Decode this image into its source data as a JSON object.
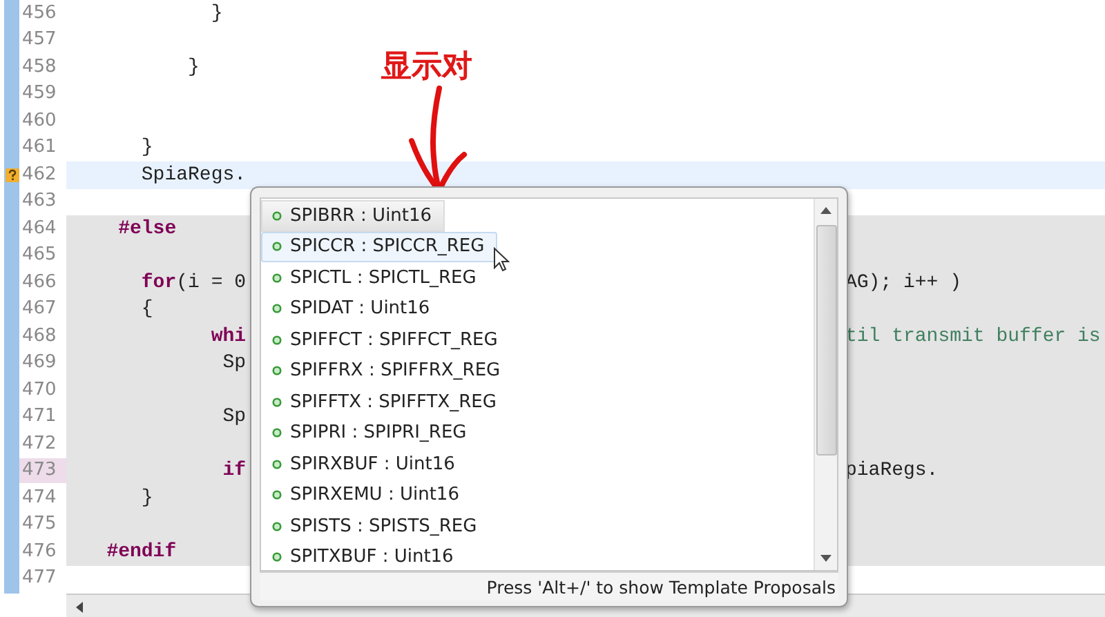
{
  "editor": {
    "lines": [
      {
        "number": "456",
        "current": false,
        "inactive": false,
        "number_highlight": false,
        "marker": false,
        "code": [
          {
            "text": "            }",
            "kind": "plain"
          }
        ]
      },
      {
        "number": "457",
        "current": false,
        "inactive": false,
        "number_highlight": false,
        "marker": false
      },
      {
        "number": "458",
        "current": false,
        "inactive": false,
        "number_highlight": false,
        "marker": false,
        "code": [
          {
            "text": "          }",
            "kind": "plain"
          }
        ]
      },
      {
        "number": "459",
        "current": false,
        "inactive": false,
        "number_highlight": false,
        "marker": false
      },
      {
        "number": "460",
        "current": false,
        "inactive": false,
        "number_highlight": false,
        "marker": false
      },
      {
        "number": "461",
        "current": false,
        "inactive": false,
        "number_highlight": false,
        "marker": false,
        "code": [
          {
            "text": "      }",
            "kind": "plain"
          }
        ]
      },
      {
        "number": "462",
        "current": true,
        "inactive": false,
        "number_highlight": false,
        "marker": true,
        "code": [
          {
            "text": "      SpiaRegs.",
            "kind": "plain"
          }
        ]
      },
      {
        "number": "463",
        "current": false,
        "inactive": false,
        "number_highlight": false,
        "marker": false
      },
      {
        "number": "464",
        "current": false,
        "inactive": true,
        "number_highlight": false,
        "marker": false,
        "code": [
          {
            "text": "    #else",
            "kind": "keyword"
          }
        ]
      },
      {
        "number": "465",
        "current": false,
        "inactive": true,
        "number_highlight": false,
        "marker": false
      },
      {
        "number": "466",
        "current": false,
        "inactive": true,
        "number_highlight": false,
        "marker": false,
        "code": [
          {
            "text": "      for",
            "kind": "keyword"
          },
          {
            "text": "(i = 0",
            "kind": "plain"
          }
        ],
        "tail": [
          {
            "text": "AG); i++ )",
            "kind": "plain"
          }
        ]
      },
      {
        "number": "467",
        "current": false,
        "inactive": true,
        "number_highlight": false,
        "marker": false,
        "code": [
          {
            "text": "      {",
            "kind": "plain"
          }
        ]
      },
      {
        "number": "468",
        "current": false,
        "inactive": true,
        "number_highlight": false,
        "marker": false,
        "code": [
          {
            "text": "            whi",
            "kind": "keyword"
          }
        ],
        "tail": [
          {
            "text": "til transmit buffer is",
            "kind": "comment"
          }
        ]
      },
      {
        "number": "469",
        "current": false,
        "inactive": true,
        "number_highlight": false,
        "marker": false,
        "code": [
          {
            "text": "             Sp",
            "kind": "plain"
          }
        ]
      },
      {
        "number": "470",
        "current": false,
        "inactive": true,
        "number_highlight": false,
        "marker": false
      },
      {
        "number": "471",
        "current": false,
        "inactive": true,
        "number_highlight": false,
        "marker": false,
        "code": [
          {
            "text": "             Sp",
            "kind": "plain"
          }
        ]
      },
      {
        "number": "472",
        "current": false,
        "inactive": true,
        "number_highlight": false,
        "marker": false
      },
      {
        "number": "473",
        "current": false,
        "inactive": true,
        "number_highlight": true,
        "marker": false,
        "code": [
          {
            "text": "             if",
            "kind": "keyword"
          }
        ],
        "tail": [
          {
            "text": "piaRegs.",
            "kind": "plain"
          }
        ]
      },
      {
        "number": "474",
        "current": false,
        "inactive": true,
        "number_highlight": false,
        "marker": false,
        "code": [
          {
            "text": "      }",
            "kind": "plain"
          }
        ]
      },
      {
        "number": "475",
        "current": false,
        "inactive": true,
        "number_highlight": false,
        "marker": false
      },
      {
        "number": "476",
        "current": false,
        "inactive": true,
        "number_highlight": false,
        "marker": false,
        "code": [
          {
            "text": "   #endif",
            "kind": "keyword"
          }
        ]
      },
      {
        "number": "477",
        "current": false,
        "inactive": false,
        "number_highlight": false,
        "marker": false
      }
    ]
  },
  "completion_popup": {
    "items": [
      {
        "label": "SPIBRR : Uint16",
        "selected": true,
        "hovered": false
      },
      {
        "label": "SPICCR : SPICCR_REG",
        "selected": false,
        "hovered": true
      },
      {
        "label": "SPICTL : SPICTL_REG",
        "selected": false,
        "hovered": false
      },
      {
        "label": "SPIDAT : Uint16",
        "selected": false,
        "hovered": false
      },
      {
        "label": "SPIFFCT : SPIFFCT_REG",
        "selected": false,
        "hovered": false
      },
      {
        "label": "SPIFFRX : SPIFFRX_REG",
        "selected": false,
        "hovered": false
      },
      {
        "label": "SPIFFTX : SPIFFTX_REG",
        "selected": false,
        "hovered": false
      },
      {
        "label": "SPIPRI : SPIPRI_REG",
        "selected": false,
        "hovered": false
      },
      {
        "label": "SPIRXBUF : Uint16",
        "selected": false,
        "hovered": false
      },
      {
        "label": "SPIRXEMU : Uint16",
        "selected": false,
        "hovered": false
      },
      {
        "label": "SPISTS : SPISTS_REG",
        "selected": false,
        "hovered": false
      },
      {
        "label": "SPITXBUF : Uint16",
        "selected": false,
        "hovered": false
      }
    ],
    "footer": "Press 'Alt+/' to show Template Proposals"
  },
  "annotation": {
    "text": "显示对"
  }
}
